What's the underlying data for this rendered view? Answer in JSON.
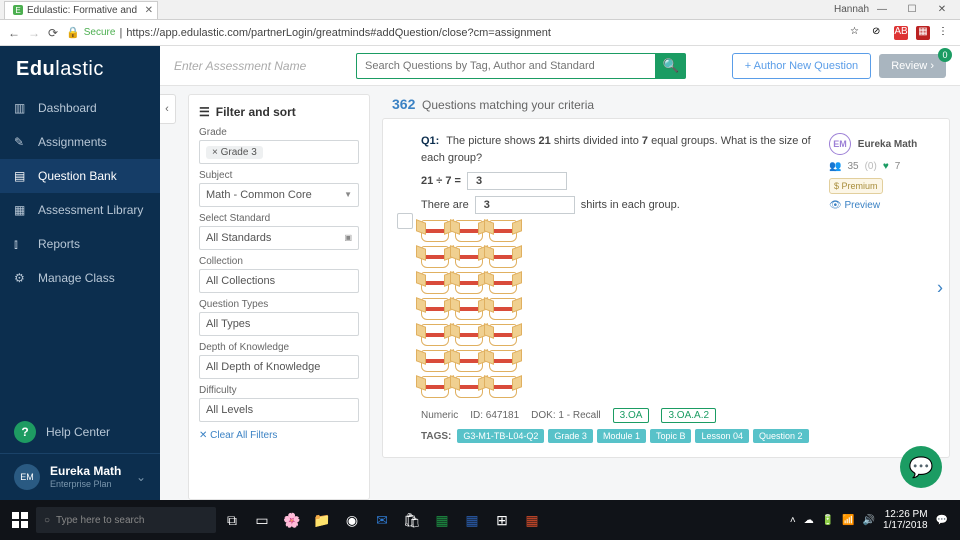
{
  "browser": {
    "tab_title": "Edulastic: Formative and",
    "user_label": "Hannah",
    "url_secure": "Secure",
    "url": "https://app.edulastic.com/partnerLogin/greatminds#addQuestion/close?cm=assignment"
  },
  "brand": {
    "part1": "Edu",
    "part2": "lastic"
  },
  "sidebar": {
    "items": [
      {
        "label": "Dashboard"
      },
      {
        "label": "Assignments"
      },
      {
        "label": "Question Bank"
      },
      {
        "label": "Assessment Library"
      },
      {
        "label": "Reports"
      },
      {
        "label": "Manage Class"
      }
    ],
    "help": "Help Center",
    "profile": {
      "initials": "EM",
      "name": "Eureka Math",
      "plan": "Enterprise Plan"
    }
  },
  "topbar": {
    "assessment_placeholder": "Enter Assessment Name",
    "search_placeholder": "Search Questions by Tag, Author and Standard",
    "author_btn": "+  Author New Question",
    "review_btn": "Review",
    "review_count": "0"
  },
  "filter": {
    "title": "Filter and sort",
    "grade_label": "Grade",
    "grade_value": "× Grade 3",
    "subject_label": "Subject",
    "subject_value": "Math - Common Core",
    "standard_label": "Select Standard",
    "standard_value": "All Standards",
    "collection_label": "Collection",
    "collection_value": "All Collections",
    "qtypes_label": "Question Types",
    "qtypes_value": "All Types",
    "dok_label": "Depth of Knowledge",
    "dok_value": "All Depth of Knowledge",
    "difficulty_label": "Difficulty",
    "difficulty_value": "All Levels",
    "clear": "✕ Clear All Filters"
  },
  "results": {
    "count": "362",
    "count_suffix": "Questions matching your criteria"
  },
  "question": {
    "number": "Q1:",
    "text_a": "The picture shows ",
    "text_b": "21",
    "text_c": " shirts divided into ",
    "text_d": "7",
    "text_e": " equal groups. What is the size of each group?",
    "eq_left": "21 ÷ 7 =",
    "eq_ans": "3",
    "text_f": "There are ",
    "eq_ans2": "3",
    "text_g": " shirts in each group.",
    "type": "Numeric",
    "id_label": "ID:",
    "id": "647181",
    "dok_label": "DOK:",
    "dok": "1 - Recall",
    "std1": "3.OA",
    "std2": "3.OA.A.2",
    "tags_label": "TAGS:",
    "tags": [
      "G3-M1-TB-L04-Q2",
      "Grade 3",
      "Module 1",
      "Topic B",
      "Lesson 04",
      "Question 2"
    ]
  },
  "source": {
    "initials": "EM",
    "name": "Eureka Math",
    "users": "35",
    "users_paren": "(0)",
    "hearts": "7",
    "premium": "$ Premium",
    "preview": "Preview"
  },
  "chart_data": null,
  "taskbar": {
    "search_placeholder": "Type here to search",
    "time": "12:26 PM",
    "date": "1/17/2018"
  }
}
